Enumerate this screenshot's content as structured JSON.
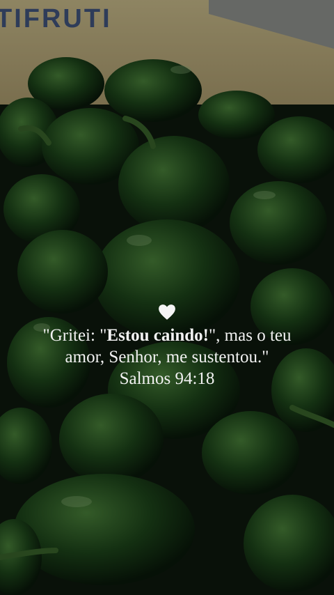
{
  "background": {
    "sign_text": "TIFRUTI",
    "subject": "green-bell-peppers-photo",
    "wall_color": "#c9b88a",
    "pepper_color": "#244f1e"
  },
  "quote": {
    "heart_icon": "white-heart-icon",
    "line1_pre": "\"Gritei: \"",
    "line1_bold": "Estou caindo!",
    "line1_post": "\", mas o teu",
    "line2": "amor, Senhor, me sustentou.\"",
    "reference": "Salmos 94:18",
    "text_color": "#f2f2f2"
  }
}
